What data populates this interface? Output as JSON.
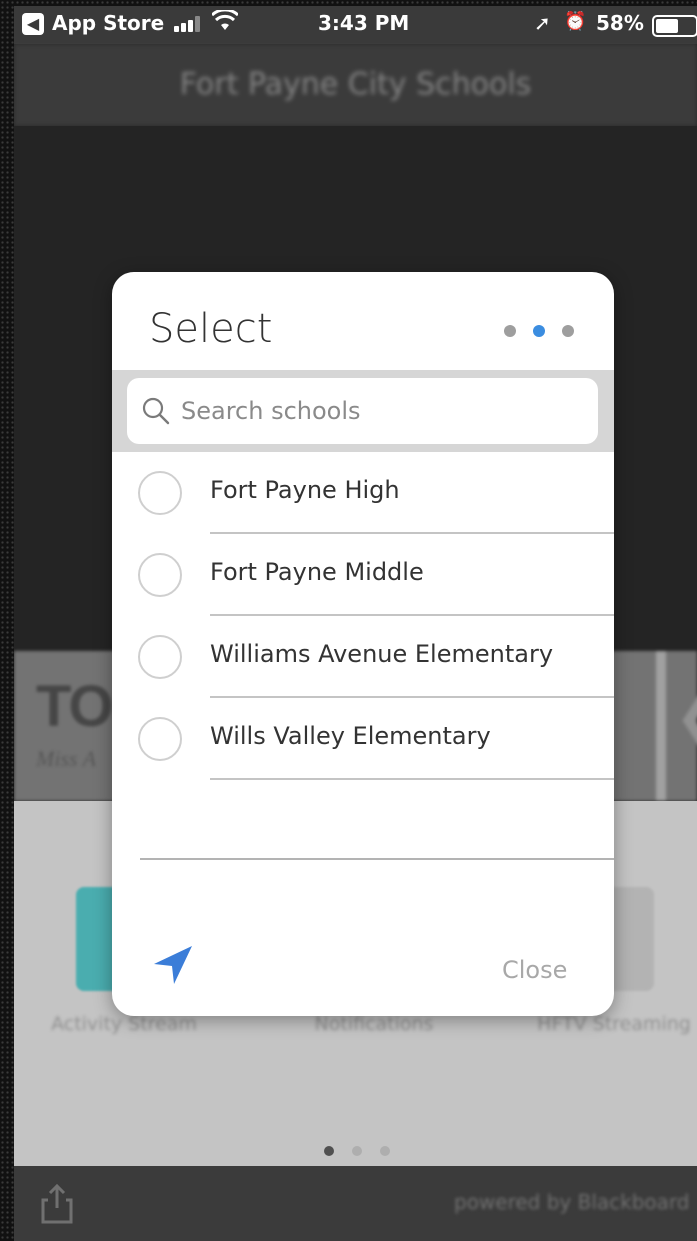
{
  "status_bar": {
    "back_label": "App Store",
    "time": "3:43 PM",
    "battery": "58%",
    "icons": [
      "back-arrow-icon",
      "signal-icon",
      "wifi-icon",
      "location-arrow-icon",
      "alarm-icon",
      "battery-icon"
    ]
  },
  "app": {
    "header_title": "Fort Payne City Schools",
    "banner_title": "TOP",
    "banner_subtitle": "Miss A",
    "tiles": [
      {
        "label": "Activity Stream",
        "color": "#4fb7b9"
      },
      {
        "label": "Notifications",
        "color": "#d8d8d8"
      },
      {
        "label": "HFTV Streaming",
        "color": "#bdbdbd"
      }
    ],
    "footer_powered": "powered by Blackboard"
  },
  "modal": {
    "title": "Select",
    "step_count": 3,
    "active_step": 2,
    "search": {
      "placeholder": "Search schools",
      "value": ""
    },
    "schools": [
      {
        "label": "Fort Payne High",
        "selected": false
      },
      {
        "label": "Fort Payne Middle",
        "selected": false
      },
      {
        "label": "Williams Avenue Elementary",
        "selected": false
      },
      {
        "label": "Wills Valley Elementary",
        "selected": false
      }
    ],
    "close_label": "Close",
    "accent_color": "#3b7dd8"
  }
}
